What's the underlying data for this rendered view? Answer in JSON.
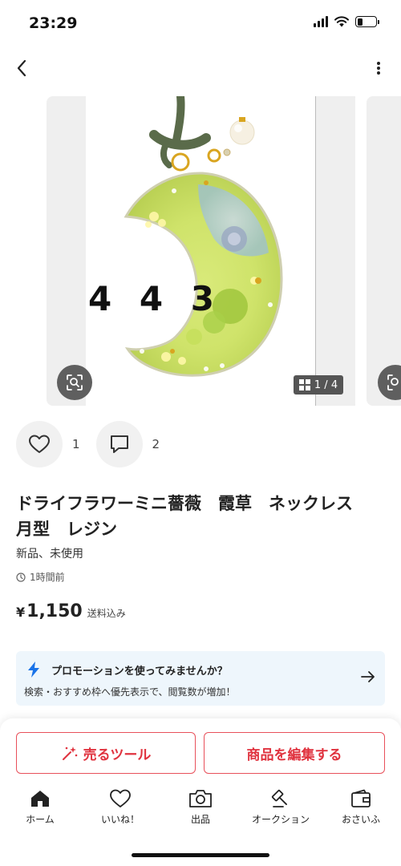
{
  "status_bar": {
    "time": "23:29",
    "battery_fraction": 0.3
  },
  "product": {
    "image_watermark": "4 4 3",
    "page_current": "1",
    "page_total": "4",
    "page_separator": "/",
    "likes_count": "1",
    "comments_count": "2",
    "title": "ドライフラワーミニ薔薇　霞草　ネックレス　月型　レジン",
    "condition": "新品、未使用",
    "posted": "1時間前",
    "price_symbol": "¥",
    "price_value": "1,150",
    "price_note": "送料込み"
  },
  "promo": {
    "title": "プロモーションを使ってみませんか？",
    "description": "検索・おすすめ枠へ優先表示で、閲覧数が増加！"
  },
  "bottom_actions": {
    "sell_tools_label": "売るツール",
    "edit_label": "商品を編集する"
  },
  "tabbar": {
    "items": [
      {
        "label": "ホーム",
        "icon": "home-icon"
      },
      {
        "label": "いいね！",
        "icon": "heart-icon"
      },
      {
        "label": "出品",
        "icon": "camera-icon"
      },
      {
        "label": "オークション",
        "icon": "gavel-icon"
      },
      {
        "label": "おさいふ",
        "icon": "wallet-icon"
      }
    ]
  },
  "colors": {
    "accent_red": "#e0333f",
    "promo_bg": "#eef6fc",
    "promo_icon": "#1a73e8"
  }
}
